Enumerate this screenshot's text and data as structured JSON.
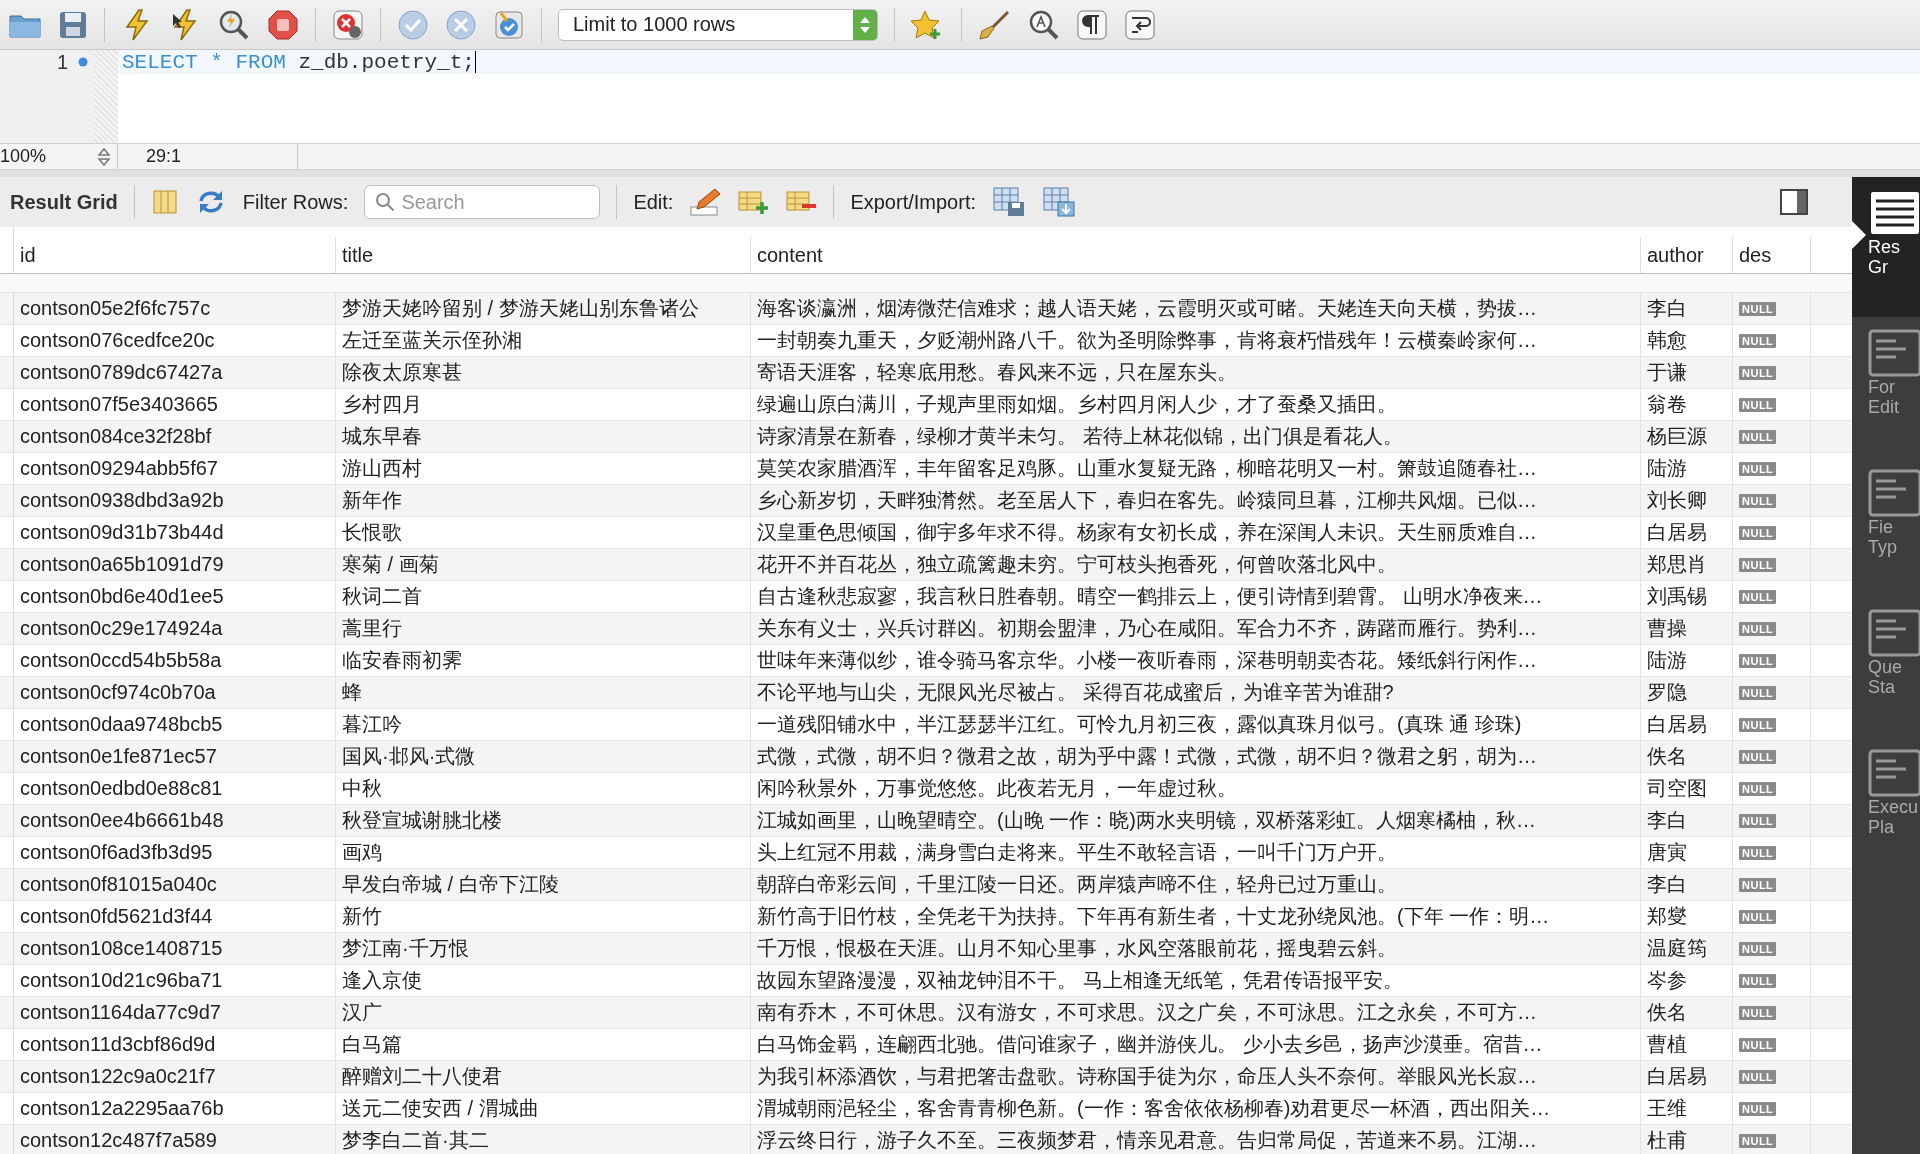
{
  "toolbar": {
    "row_limit": "Limit to 1000 rows"
  },
  "editor": {
    "lines": [
      {
        "number": "1",
        "marker": true,
        "tokens": [
          {
            "kind": "keyword",
            "text": "SELECT"
          },
          {
            "kind": "keyword",
            "text": "*"
          },
          {
            "kind": "keyword",
            "text": "FROM"
          },
          {
            "kind": "plain",
            "text": "z_db.poetry_t;"
          }
        ]
      }
    ],
    "zoom": "100%",
    "cursor_position": "29:1"
  },
  "result_bar": {
    "title": "Result Grid",
    "filter_label": "Filter Rows:",
    "search_placeholder": "Search",
    "edit_label": "Edit:",
    "export_label": "Export/Import:"
  },
  "grid": {
    "columns": [
      "id",
      "title",
      "content",
      "author",
      "des"
    ],
    "rows": [
      {
        "id": "contson05e2f6fc757c",
        "title": "梦游天姥吟留别 / 梦游天姥山别东鲁诸公",
        "content": "海客谈瀛洲，烟涛微茫信难求；越人语天姥，云霞明灭或可睹。天姥连天向天横，势拔…",
        "author": "李白",
        "des": "NULL"
      },
      {
        "id": "contson076cedfce20c",
        "title": "左迁至蓝关示侄孙湘",
        "content": "一封朝奏九重天，夕贬潮州路八千。欲为圣明除弊事，肯将衰朽惜残年！云横秦岭家何…",
        "author": "韩愈",
        "des": "NULL"
      },
      {
        "id": "contson0789dc67427a",
        "title": "除夜太原寒甚",
        "content": "寄语天涯客，轻寒底用愁。春风来不远，只在屋东头。",
        "author": "于谦",
        "des": "NULL"
      },
      {
        "id": "contson07f5e3403665",
        "title": "乡村四月",
        "content": "绿遍山原白满川，子规声里雨如烟。乡村四月闲人少，才了蚕桑又插田。",
        "author": "翁卷",
        "des": "NULL"
      },
      {
        "id": "contson084ce32f28bf",
        "title": "城东早春",
        "content": "诗家清景在新春，绿柳才黄半未匀。 若待上林花似锦，出门俱是看花人。",
        "author": "杨巨源",
        "des": "NULL"
      },
      {
        "id": "contson09294abb5f67",
        "title": "游山西村",
        "content": "莫笑农家腊酒浑，丰年留客足鸡豚。山重水复疑无路，柳暗花明又一村。箫鼓追随春社…",
        "author": "陆游",
        "des": "NULL"
      },
      {
        "id": "contson0938dbd3a92b",
        "title": "新年作",
        "content": "乡心新岁切，天畔独潸然。老至居人下，春归在客先。岭猿同旦暮，江柳共风烟。已似…",
        "author": "刘长卿",
        "des": "NULL"
      },
      {
        "id": "contson09d31b73b44d",
        "title": "长恨歌",
        "content": "汉皇重色思倾国，御宇多年求不得。杨家有女初长成，养在深闺人未识。天生丽质难自…",
        "author": "白居易",
        "des": "NULL"
      },
      {
        "id": "contson0a65b1091d79",
        "title": "寒菊 / 画菊",
        "content": "花开不并百花丛，独立疏篱趣未穷。宁可枝头抱香死，何曾吹落北风中。",
        "author": "郑思肖",
        "des": "NULL"
      },
      {
        "id": "contson0bd6e40d1ee5",
        "title": "秋词二首",
        "content": "自古逢秋悲寂寥，我言秋日胜春朝。晴空一鹤排云上，便引诗情到碧霄。 山明水净夜来…",
        "author": "刘禹锡",
        "des": "NULL"
      },
      {
        "id": "contson0c29e174924a",
        "title": "蒿里行",
        "content": "关东有义士，兴兵讨群凶。初期会盟津，乃心在咸阳。军合力不齐，踌躇而雁行。势利…",
        "author": "曹操",
        "des": "NULL"
      },
      {
        "id": "contson0ccd54b5b58a",
        "title": "临安春雨初霁",
        "content": "世味年来薄似纱，谁令骑马客京华。小楼一夜听春雨，深巷明朝卖杏花。矮纸斜行闲作…",
        "author": "陆游",
        "des": "NULL"
      },
      {
        "id": "contson0cf974c0b70a",
        "title": "蜂",
        "content": "不论平地与山尖，无限风光尽被占。 采得百花成蜜后，为谁辛苦为谁甜?",
        "author": "罗隐",
        "des": "NULL"
      },
      {
        "id": "contson0daa9748bcb5",
        "title": "暮江吟",
        "content": "一道残阳铺水中，半江瑟瑟半江红。可怜九月初三夜，露似真珠月似弓。(真珠 通 珍珠)",
        "author": "白居易",
        "des": "NULL"
      },
      {
        "id": "contson0e1fe871ec57",
        "title": "国风·邶风·式微",
        "content": "式微，式微，胡不归？微君之故，胡为乎中露！式微，式微，胡不归？微君之躬，胡为…",
        "author": "佚名",
        "des": "NULL"
      },
      {
        "id": "contson0edbd0e88c81",
        "title": "中秋",
        "content": "闲吟秋景外，万事觉悠悠。此夜若无月，一年虚过秋。",
        "author": "司空图",
        "des": "NULL"
      },
      {
        "id": "contson0ee4b6661b48",
        "title": "秋登宣城谢朓北楼",
        "content": "江城如画里，山晚望晴空。(山晚 一作：晓)两水夹明镜，双桥落彩虹。人烟寒橘柚，秋…",
        "author": "李白",
        "des": "NULL"
      },
      {
        "id": "contson0f6ad3fb3d95",
        "title": "画鸡",
        "content": "头上红冠不用裁，满身雪白走将来。平生不敢轻言语，一叫千门万户开。",
        "author": "唐寅",
        "des": "NULL"
      },
      {
        "id": "contson0f81015a040c",
        "title": "早发白帝城 / 白帝下江陵",
        "content": "朝辞白帝彩云间，千里江陵一日还。两岸猿声啼不住，轻舟已过万重山。",
        "author": "李白",
        "des": "NULL"
      },
      {
        "id": "contson0fd5621d3f44",
        "title": "新竹",
        "content": "新竹高于旧竹枝，全凭老干为扶持。下年再有新生者，十丈龙孙绕凤池。(下年 一作：明…",
        "author": "郑燮",
        "des": "NULL"
      },
      {
        "id": "contson108ce1408715",
        "title": "梦江南·千万恨",
        "content": "千万恨，恨极在天涯。山月不知心里事，水风空落眼前花，摇曳碧云斜。",
        "author": "温庭筠",
        "des": "NULL"
      },
      {
        "id": "contson10d21c96ba71",
        "title": "逢入京使",
        "content": "故园东望路漫漫，双袖龙钟泪不干。 马上相逢无纸笔，凭君传语报平安。",
        "author": "岑参",
        "des": "NULL"
      },
      {
        "id": "contson1164da77c9d7",
        "title": "汉广",
        "content": "南有乔木，不可休思。汉有游女，不可求思。汉之广矣，不可泳思。江之永矣，不可方…",
        "author": "佚名",
        "des": "NULL"
      },
      {
        "id": "contson11d3cbf86d9d",
        "title": "白马篇",
        "content": "白马饰金羁，连翩西北驰。借问谁家子，幽并游侠儿。 少小去乡邑，扬声沙漠垂。宿昔…",
        "author": "曹植",
        "des": "NULL"
      },
      {
        "id": "contson122c9a0c21f7",
        "title": "醉赠刘二十八使君",
        "content": "为我引杯添酒饮，与君把箸击盘歌。诗称国手徒为尔，命压人头不奈何。举眼风光长寂…",
        "author": "白居易",
        "des": "NULL"
      },
      {
        "id": "contson12a2295aa76b",
        "title": "送元二使安西 / 渭城曲",
        "content": "渭城朝雨浥轻尘，客舍青青柳色新。(一作：客舍依依杨柳春)劝君更尽一杯酒，西出阳关…",
        "author": "王维",
        "des": "NULL"
      },
      {
        "id": "contson12c487f7a589",
        "title": "梦李白二首·其二",
        "content": "浮云终日行，游子久不至。三夜频梦君，情亲见君意。告归常局促，苦道来不易。江湖…",
        "author": "杜甫",
        "des": "NULL"
      }
    ]
  },
  "sidebar": {
    "items": [
      {
        "lines": [
          "Res",
          "Gr"
        ],
        "selected": true
      },
      {
        "lines": [
          "For",
          "Edit"
        ],
        "selected": false
      },
      {
        "lines": [
          "Fie",
          "Typ"
        ],
        "selected": false
      },
      {
        "lines": [
          "Que",
          "Sta"
        ],
        "selected": false
      },
      {
        "lines": [
          "Execu",
          "Pla"
        ],
        "selected": false
      }
    ]
  }
}
